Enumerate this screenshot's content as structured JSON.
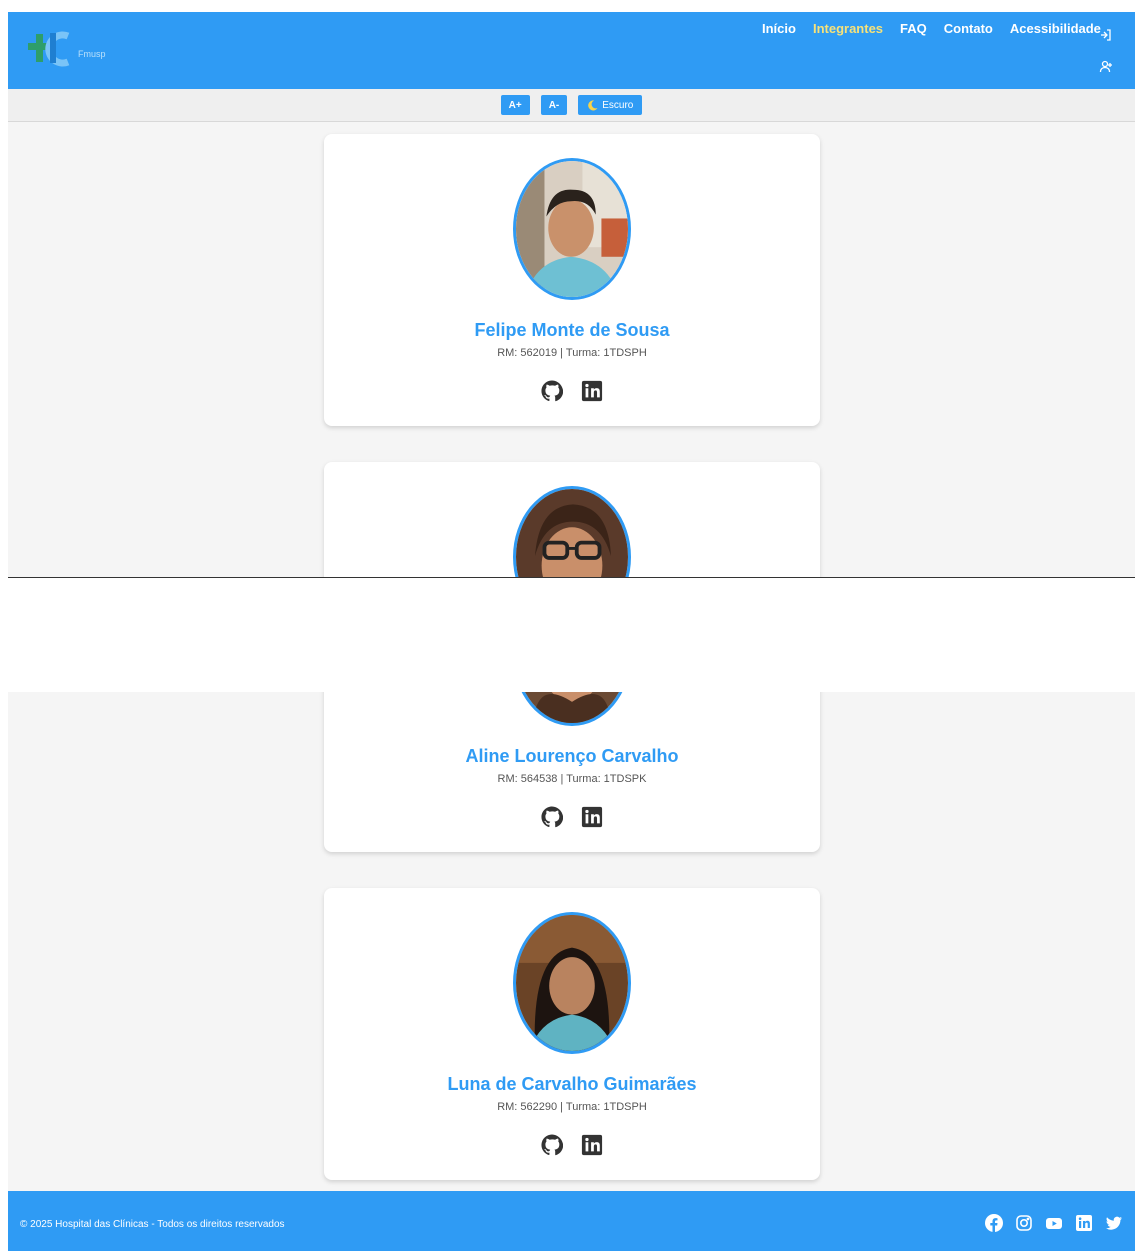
{
  "nav": {
    "items": [
      {
        "label": "Início",
        "active": false
      },
      {
        "label": "Integrantes",
        "active": true
      },
      {
        "label": "FAQ",
        "active": false
      },
      {
        "label": "Contato",
        "active": false
      },
      {
        "label": "Acessibilidade",
        "active": false
      }
    ],
    "logo_text": "Fmusp"
  },
  "accessibility": {
    "increase_label": "A+",
    "decrease_label": "A-",
    "dark_label": "Escuro"
  },
  "members": [
    {
      "name": "Felipe Monte de Sousa",
      "info": "RM: 562019 | Turma: 1TDSPH"
    },
    {
      "name": "Aline Lourenço Carvalho",
      "info": "RM: 564538 | Turma: 1TDSPK"
    },
    {
      "name": "Luna de Carvalho Guimarães",
      "info": "RM: 562290 | Turma: 1TDSPH"
    }
  ],
  "footer": {
    "copyright": "© 2025 Hospital das Clínicas - Todos os direitos reservados",
    "social_icons": [
      "facebook-icon",
      "instagram-icon",
      "youtube-icon",
      "linkedin-icon",
      "twitter-icon"
    ]
  },
  "colors": {
    "primary": "#2f9bf4",
    "active_nav": "#f6e27a",
    "background": "#f5f5f5"
  }
}
